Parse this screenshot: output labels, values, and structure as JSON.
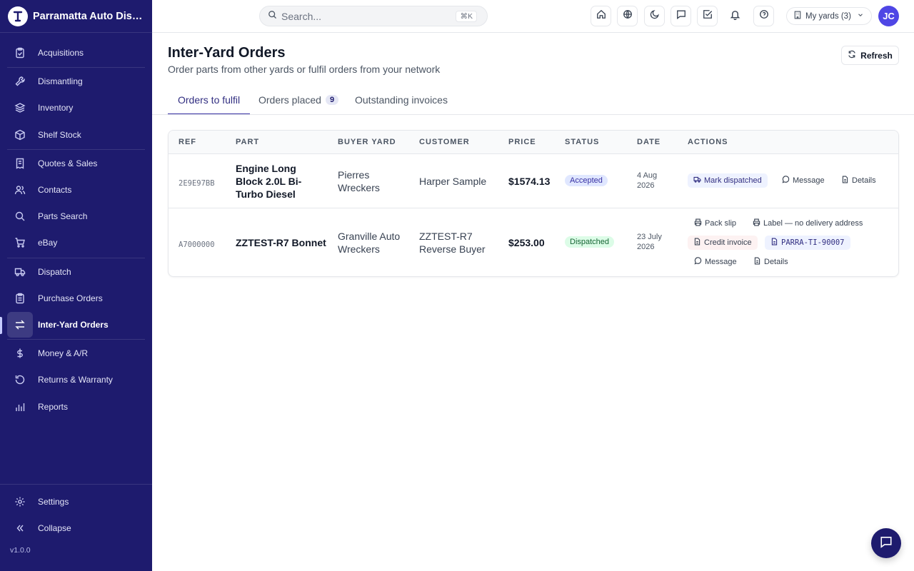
{
  "brand": {
    "name": "Parramatta Auto Dismantlers"
  },
  "sidebar": {
    "items": [
      {
        "label": "Acquisitions",
        "icon": "clipboard-icon"
      },
      {
        "label": "Dismantling",
        "icon": "wrench-icon"
      },
      {
        "label": "Inventory",
        "icon": "layers-icon"
      },
      {
        "label": "Shelf Stock",
        "icon": "box-icon"
      },
      {
        "label": "Quotes & Sales",
        "icon": "receipt-icon"
      },
      {
        "label": "Contacts",
        "icon": "users-icon"
      },
      {
        "label": "Parts Search",
        "icon": "search-icon"
      },
      {
        "label": "eBay",
        "icon": "cart-icon"
      },
      {
        "label": "Dispatch",
        "icon": "truck-icon"
      },
      {
        "label": "Purchase Orders",
        "icon": "clipboard-list-icon"
      },
      {
        "label": "Inter-Yard Orders",
        "icon": "swap-icon",
        "active": true
      },
      {
        "label": "Money & A/R",
        "icon": "dollar-icon"
      },
      {
        "label": "Returns & Warranty",
        "icon": "rotate-icon"
      },
      {
        "label": "Reports",
        "icon": "bar-chart-icon"
      }
    ],
    "settings_label": "Settings",
    "collapse_label": "Collapse",
    "version": "v1.0.0"
  },
  "topbar": {
    "search_placeholder": "Search...",
    "shortcut": "⌘K",
    "yards_label": "My yards (3)",
    "avatar_initials": "JC"
  },
  "header": {
    "title": "Inter-Yard Orders",
    "subtitle": "Order parts from other yards or fulfil orders from your network",
    "refresh_label": "Refresh"
  },
  "tabs": [
    {
      "label": "Orders to fulfil",
      "active": true
    },
    {
      "label": "Orders placed",
      "badge": "9"
    },
    {
      "label": "Outstanding invoices"
    }
  ],
  "table": {
    "columns": [
      "REF",
      "PART",
      "BUYER YARD",
      "CUSTOMER",
      "PRICE",
      "STATUS",
      "DATE",
      "ACTIONS"
    ],
    "rows": [
      {
        "ref": "2E9E97BB",
        "part": "Engine Long Block 2.0L Bi-Turbo Diesel",
        "buyer_yard": "Pierres Wreckers",
        "customer": "Harper Sample",
        "price": "$1574.13",
        "status": "Accepted",
        "date_line1": "4 Aug",
        "date_line2": "2026",
        "actions": {
          "mark_dispatched": "Mark dispatched",
          "message": "Message",
          "details": "Details"
        }
      },
      {
        "ref": "A7000000",
        "part": "ZZTEST-R7 Bonnet",
        "buyer_yard": "Granville Auto Wreckers",
        "customer": "ZZTEST-R7 Reverse Buyer",
        "price": "$253.00",
        "status": "Dispatched",
        "date_line1": "23 July",
        "date_line2": "2026",
        "actions": {
          "pack_slip": "Pack slip",
          "label_note": "Label — no delivery address",
          "credit_invoice": "Credit invoice",
          "invoice_code": "PARRA-TI-90007",
          "message": "Message",
          "details": "Details"
        }
      }
    ]
  },
  "colors": {
    "sidebar_bg": "#1e1b6e",
    "accent": "#3730a3",
    "accepted": "#e0e7ff",
    "dispatched": "#dcfce7"
  }
}
